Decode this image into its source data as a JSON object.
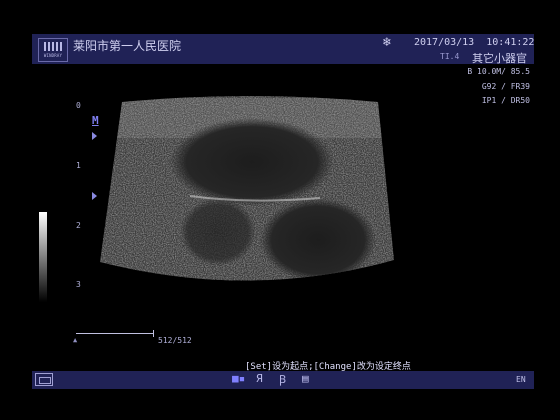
{
  "header": {
    "logo_text": "WINDRAY",
    "hospital": "莱阳市第一人民医院",
    "frozen_icon": "snowflake-icon",
    "date": "2017/03/13",
    "time": "10:41:22",
    "ti": "TI.4",
    "preset": "其它小器官"
  },
  "params": {
    "line1": "B 10.0M/ 85.5",
    "line2": "G92 / FR39",
    "line3": "IP1 / DR50"
  },
  "depth_scale": [
    "0",
    "1",
    "2",
    "3"
  ],
  "marker": "M",
  "cine": {
    "frames": "512/512"
  },
  "hint": "[Set]设为起点;[Change]改为设定终点",
  "bottom": {
    "icons": [
      "keyboard-icon",
      "mouse-button-icon",
      "ya-icon",
      "bk-icon",
      "document-icon"
    ],
    "ya_label": "Я",
    "bk_label": "Ꞵ",
    "lang": "EN"
  },
  "colors": {
    "bar": "#202256",
    "accent": "#7f7ff0",
    "background": "#000000"
  }
}
